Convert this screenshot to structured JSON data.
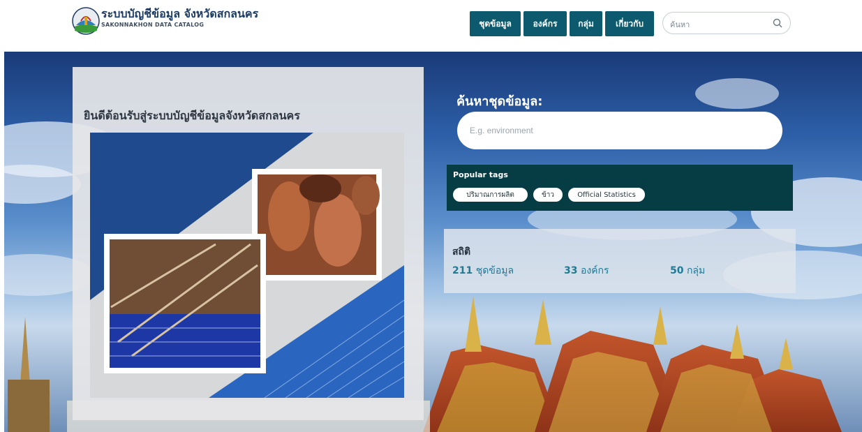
{
  "header": {
    "brand_title": "ระบบบัญชีข้อมูล จังหวัดสกลนคร",
    "brand_subtitle": "SAKONNAKHON DATA CATALOG",
    "nav": [
      {
        "label": "ชุดข้อมูล"
      },
      {
        "label": "องค์กร"
      },
      {
        "label": "กลุ่ม"
      },
      {
        "label": "เกี่ยวกับ"
      }
    ],
    "search_placeholder": "ค้นหา"
  },
  "hero": {
    "welcome": "ยินดีต้อนรับสู่ระบบบัญชีข้อมูลจังหวัดสกลนคร",
    "search_title": "ค้นหาชุดข้อมูล:",
    "search_placeholder": "E.g. environment",
    "popular_tags_title": "Popular tags",
    "tags": [
      {
        "label": "ปริมาณการผลิต"
      },
      {
        "label": "ข้าว"
      },
      {
        "label": "Official Statistics"
      }
    ],
    "stats_title": "สถิติ",
    "stats": [
      {
        "count": "211",
        "label": "ชุดข้อมูล"
      },
      {
        "count": "33",
        "label": "องค์กร"
      },
      {
        "count": "50",
        "label": "กลุ่ม"
      }
    ]
  },
  "colors": {
    "nav_bg": "#0d5a6e",
    "tags_bg": "#063d44",
    "stat_text": "#217a95"
  },
  "icons": {
    "logo": "provincial-seal-logo",
    "search": "search-icon"
  }
}
